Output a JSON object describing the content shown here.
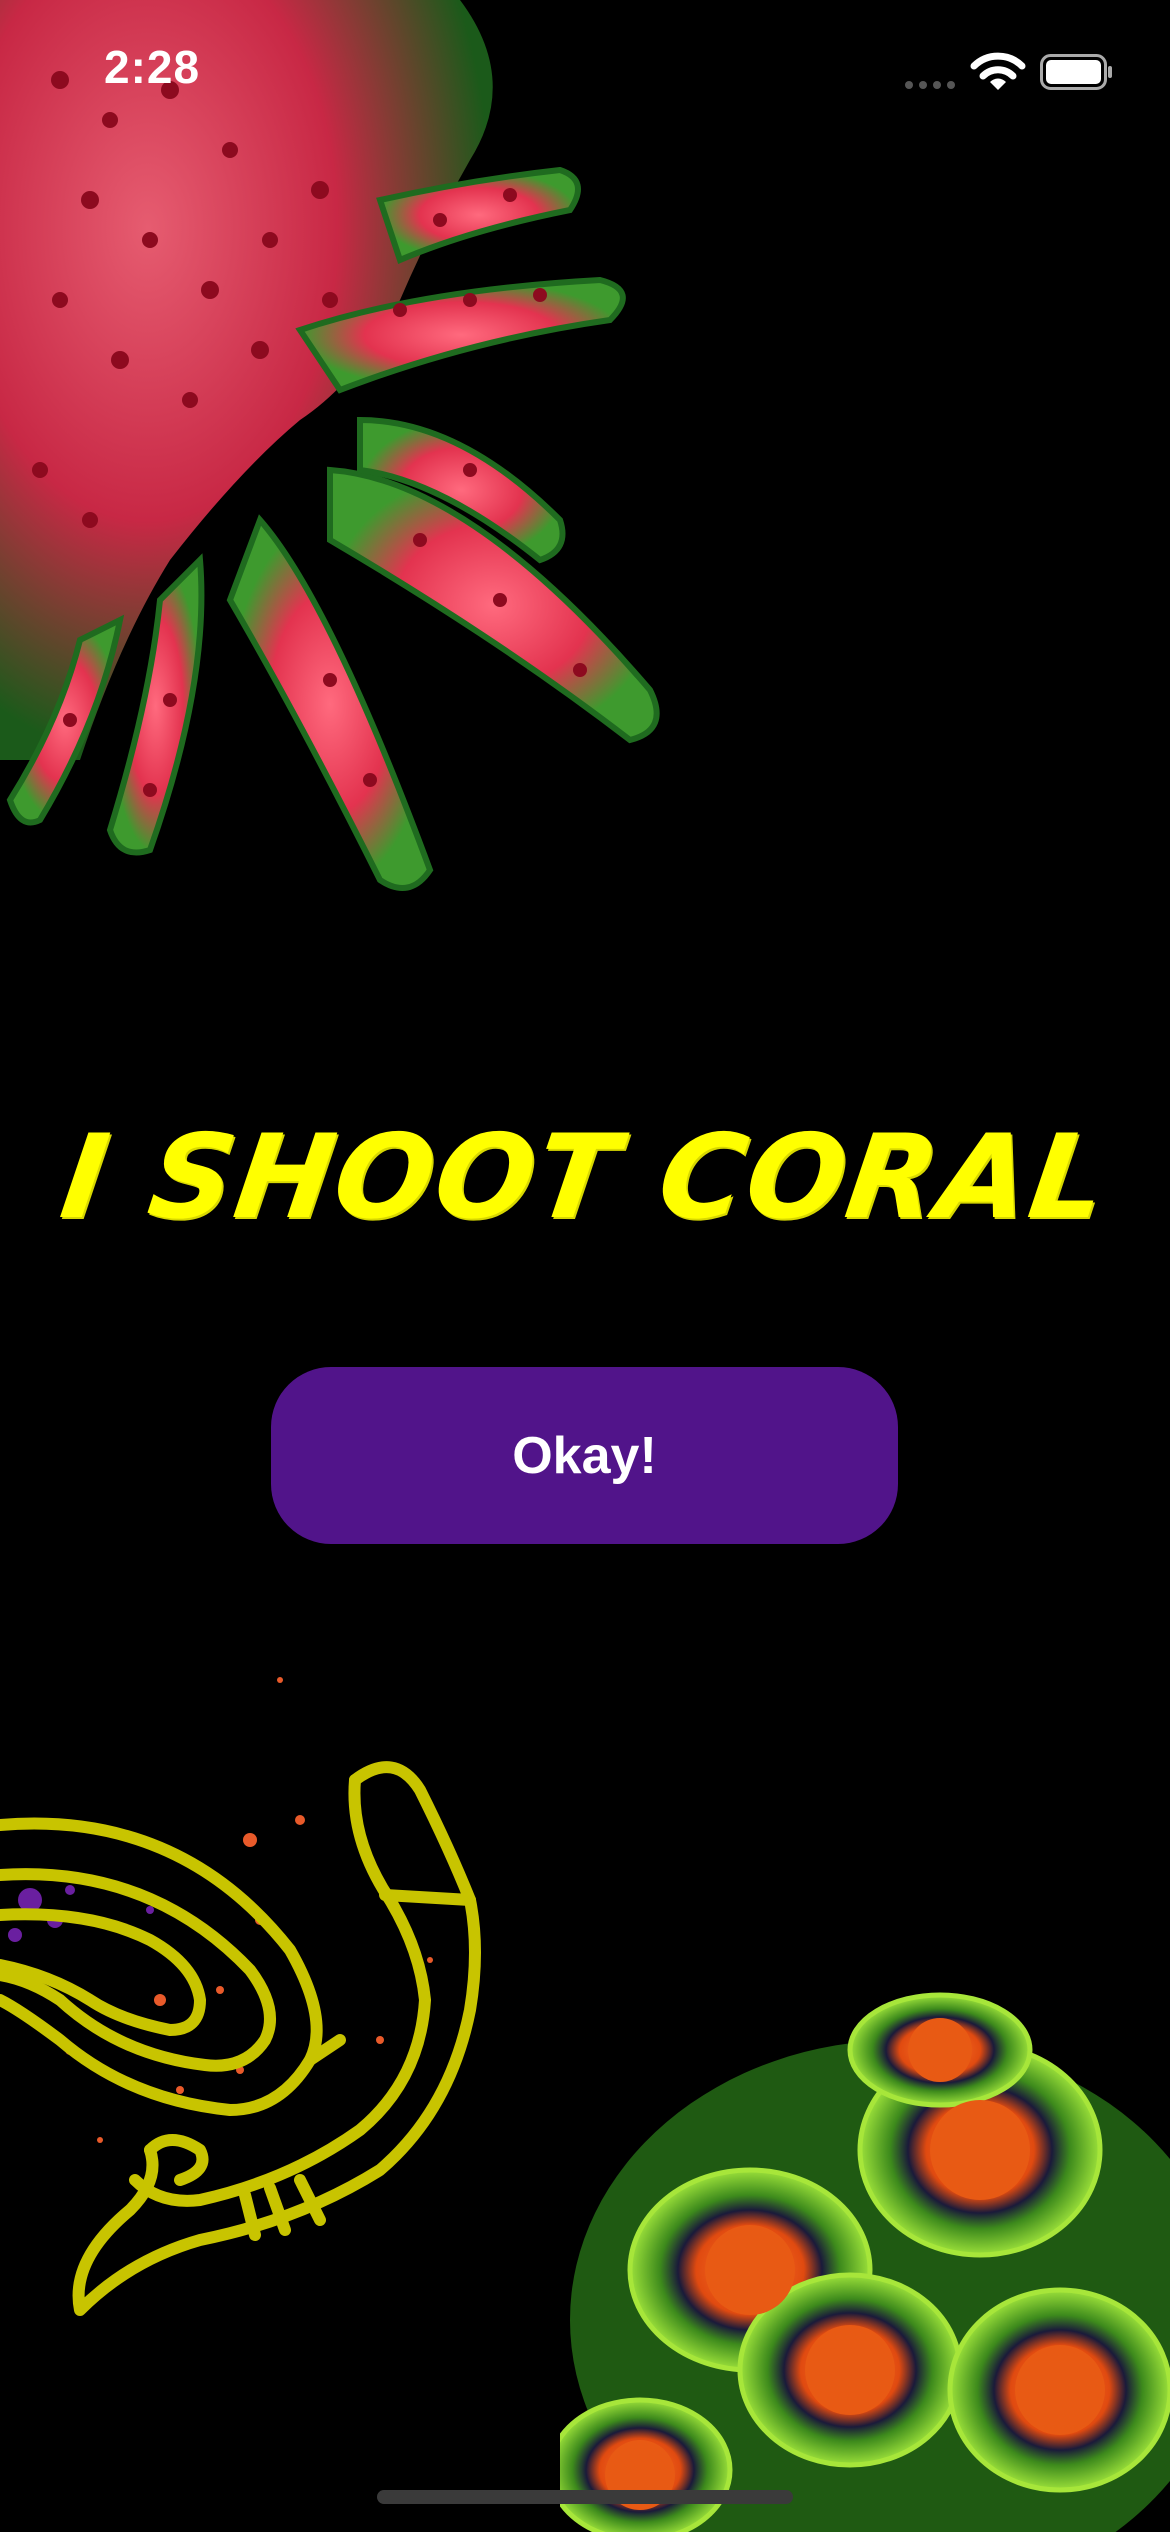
{
  "status_bar": {
    "time": "2:28"
  },
  "main": {
    "title": "I SHOOT CORAL",
    "okay_button_label": "Okay!"
  },
  "colors": {
    "background": "#000000",
    "title": "#ffff00",
    "button": "#51148a",
    "button_text": "#ffffff",
    "coral_pink": "#e8405c",
    "coral_green": "#5fbf2a",
    "coral_orange": "#e85a14",
    "snorkel_line": "#c8c400"
  },
  "icons": [
    "cellular-signal-icon",
    "wifi-icon",
    "battery-icon",
    "goggles-snorkel-illustration"
  ]
}
